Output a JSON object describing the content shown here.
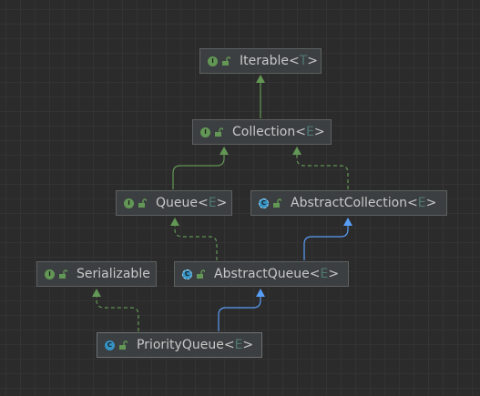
{
  "nodes": [
    {
      "id": "iterable",
      "kind": "interface",
      "kind_letter": "I",
      "name": "Iterable",
      "type_param": "T"
    },
    {
      "id": "collection",
      "kind": "interface",
      "kind_letter": "I",
      "name": "Collection",
      "type_param": "E"
    },
    {
      "id": "queue",
      "kind": "interface",
      "kind_letter": "I",
      "name": "Queue",
      "type_param": "E"
    },
    {
      "id": "abstractcollection",
      "kind": "abstract",
      "kind_letter": "C",
      "name": "AbstractCollection",
      "type_param": "E"
    },
    {
      "id": "serializable",
      "kind": "interface",
      "kind_letter": "I",
      "name": "Serializable",
      "type_param": ""
    },
    {
      "id": "abstractqueue",
      "kind": "abstract",
      "kind_letter": "C",
      "name": "AbstractQueue",
      "type_param": "E"
    },
    {
      "id": "priorityqueue",
      "kind": "class",
      "kind_letter": "C",
      "name": "PriorityQueue",
      "type_param": "E"
    }
  ],
  "edges": [
    {
      "from": "collection",
      "to": "iterable",
      "type": "extends-interface"
    },
    {
      "from": "queue",
      "to": "collection",
      "type": "extends-interface"
    },
    {
      "from": "abstractcollection",
      "to": "collection",
      "type": "implements"
    },
    {
      "from": "abstractqueue",
      "to": "queue",
      "type": "implements"
    },
    {
      "from": "abstractqueue",
      "to": "abstractcollection",
      "type": "extends-class"
    },
    {
      "from": "priorityqueue",
      "to": "serializable",
      "type": "implements"
    },
    {
      "from": "priorityqueue",
      "to": "abstractqueue",
      "type": "extends-class"
    }
  ],
  "colors": {
    "interface_extends": "#629755",
    "implements": "#629755",
    "class_extends": "#589df6",
    "interface_icon": "#629755",
    "class_icon": "#3592c4",
    "type_param": "#507874",
    "text": "#c8c8c8",
    "background": "#2b2b2b"
  },
  "icons": {
    "kind": "class-kind-badge-icon",
    "visibility": "unlocked-public-icon"
  }
}
